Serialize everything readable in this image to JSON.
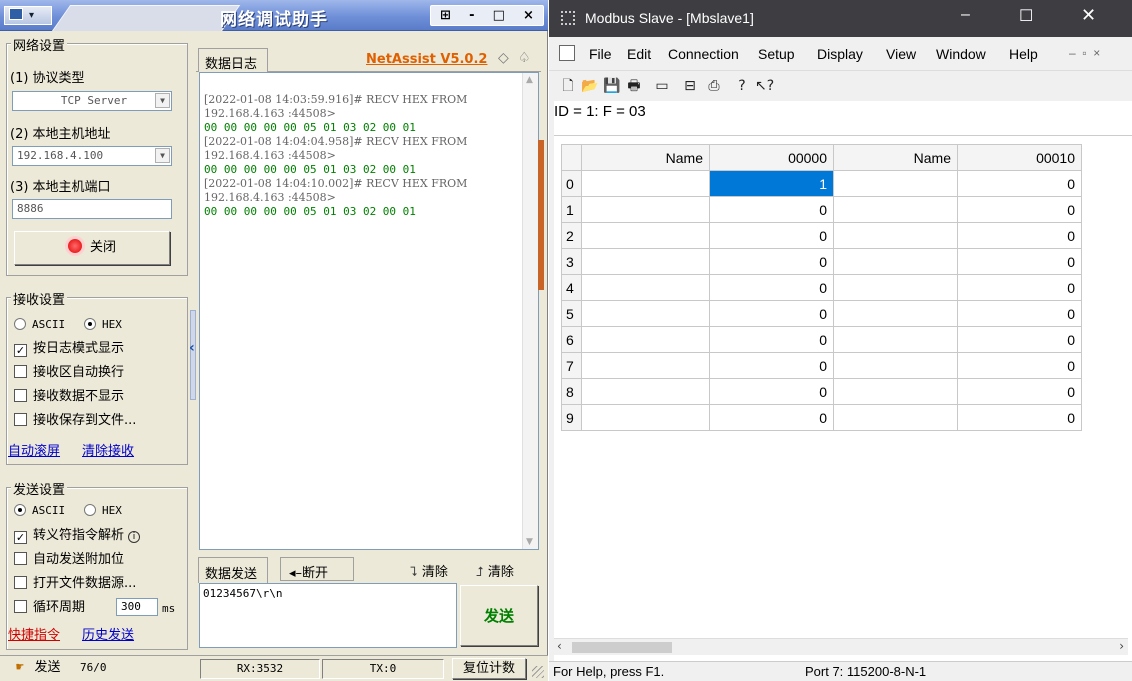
{
  "netassist": {
    "title": "网络调试助手",
    "window_controls": [
      "-",
      "□",
      "×"
    ],
    "network": {
      "caption": "网络设置",
      "protocol_label": "(1) 协议类型",
      "protocol_value": "TCP Server",
      "host_label": "(2) 本地主机地址",
      "host_value": "192.168.4.100",
      "port_label": "(3) 本地主机端口",
      "port_value": "8886",
      "close_label": "关闭"
    },
    "receive": {
      "caption": "接收设置",
      "ascii": "ASCII",
      "hex": "HEX",
      "mode": "HEX",
      "opt_log": "按日志模式显示",
      "opt_wrap": "接收区自动换行",
      "opt_hide": "接收数据不显示",
      "opt_save": "接收保存到文件...",
      "opt_log_checked": true,
      "auto_scroll": "自动滚屏",
      "clear_recv": "清除接收"
    },
    "send": {
      "caption": "发送设置",
      "ascii": "ASCII",
      "hex": "HEX",
      "mode": "ASCII",
      "opt_escape": "转义符指令解析",
      "opt_escape_checked": true,
      "opt_append": "自动发送附加位",
      "opt_file": "打开文件数据源...",
      "opt_loop": "循环周期",
      "loop_value": "300",
      "loop_unit": "ms",
      "shortcut": "快捷指令",
      "history": "历史发送"
    },
    "log": {
      "tab": "数据日志",
      "brand": "NetAssist V5.0.2",
      "lines": [
        {
          "text": "[2022-01-08 14:03:59.916]# RECV HEX FROM",
          "kind": "head"
        },
        {
          "text": "192.168.4.163 :44508>",
          "kind": "head"
        },
        {
          "text": "00 00 00 00 00 05 01 03 02 00 01",
          "kind": "hex"
        },
        {
          "text": "[2022-01-08 14:04:04.958]# RECV HEX FROM",
          "kind": "head"
        },
        {
          "text": "192.168.4.163 :44508>",
          "kind": "head"
        },
        {
          "text": "00 00 00 00 00 05 01 03 02 00 01",
          "kind": "hex"
        },
        {
          "text": "[2022-01-08 14:04:10.002]# RECV HEX FROM",
          "kind": "head"
        },
        {
          "text": "192.168.4.163 :44508>",
          "kind": "head"
        },
        {
          "text": "00 00 00 00 00 05 01 03 02 00 01",
          "kind": "hex"
        }
      ]
    },
    "send_area": {
      "tab": "数据发送",
      "disconnect": "断开",
      "clear1": "清除",
      "clear2": "清除",
      "text": "01234567\\r\\n",
      "send_button": "发送"
    },
    "status": {
      "send_label": "发送",
      "counts": "76/0",
      "rx": "RX:3532",
      "tx": "TX:0",
      "reset": "复位计数"
    }
  },
  "modbus": {
    "title": "Modbus Slave - [Mbslave1]",
    "menu": [
      "File",
      "Edit",
      "Connection",
      "Setup",
      "Display",
      "View",
      "Window",
      "Help"
    ],
    "id_line": "ID = 1: F = 03",
    "columns": [
      "Name",
      "00000",
      "Name",
      "00010"
    ],
    "rows": [
      {
        "n": "0",
        "a": "1",
        "b": "0"
      },
      {
        "n": "1",
        "a": "0",
        "b": "0"
      },
      {
        "n": "2",
        "a": "0",
        "b": "0"
      },
      {
        "n": "3",
        "a": "0",
        "b": "0"
      },
      {
        "n": "4",
        "a": "0",
        "b": "0"
      },
      {
        "n": "5",
        "a": "0",
        "b": "0"
      },
      {
        "n": "6",
        "a": "0",
        "b": "0"
      },
      {
        "n": "7",
        "a": "0",
        "b": "0"
      },
      {
        "n": "8",
        "a": "0",
        "b": "0"
      },
      {
        "n": "9",
        "a": "0",
        "b": "0"
      }
    ],
    "status_help": "For Help, press F1.",
    "status_port": "Port 7: 115200-8-N-1"
  }
}
